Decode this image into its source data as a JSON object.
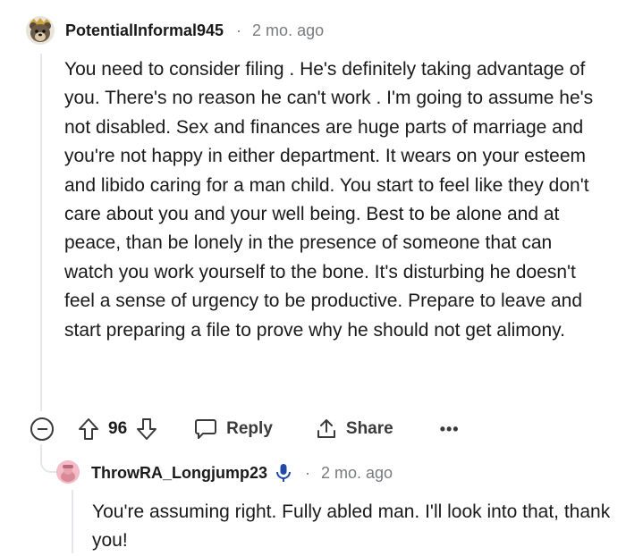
{
  "comment": {
    "username": "PotentialInformal945",
    "separator": "·",
    "timestamp": "2 mo. ago",
    "body": "You need to consider filing . He's definitely taking advantage of you. There's no reason he can't work . I'm going to assume he's not disabled. Sex and finances are huge parts of marriage and you're not happy in either department. It wears on your esteem and libido caring for a man child. You start to feel like they don't care about you and your well being. Best to be alone and at peace, than be lonely in the presence of someone that can watch you work yourself to the bone. It's disturbing he doesn't feel a sense of urgency to be productive. Prepare to leave and start preparing a file to prove why he should not get alimony.",
    "score": "96",
    "reply_label": "Reply",
    "share_label": "Share",
    "more_label": "•••"
  },
  "reply": {
    "username": "ThrowRA_Longjump23",
    "separator": "·",
    "timestamp": "2 mo. ago",
    "body": "You're assuming right. Fully abled man. I'll look into that, thank you!"
  },
  "colors": {
    "text": "#1a1a1b",
    "meta": "#787c7e",
    "thread_line": "#e5e7ea",
    "mic_badge": "#1f4aa8"
  },
  "icons": {
    "avatar1": "bear-avatar-icon",
    "avatar2": "pink-avatar-icon",
    "collapse": "collapse-circle-minus-icon",
    "upvote": "arrow-up-icon",
    "downvote": "arrow-down-icon",
    "reply": "speech-bubble-icon",
    "share": "share-upload-icon",
    "mic": "microphone-icon"
  }
}
